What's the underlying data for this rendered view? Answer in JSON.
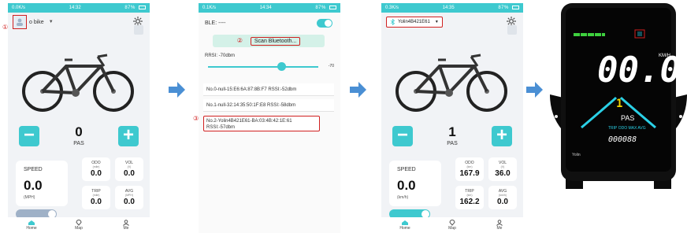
{
  "phone1": {
    "status_left": "0.0K/s",
    "status_time": "14:32",
    "status_right": "87% ",
    "annotation": "①",
    "device_name": "o bike",
    "pas_value": "0",
    "pas_label": "PAS",
    "speed": {
      "label": "SPEED",
      "value": "0.0",
      "unit": "(MPH)"
    },
    "odo": {
      "label": "ODO",
      "unit": "(mile)",
      "value": "0.0"
    },
    "vol": {
      "label": "VOL",
      "unit": "(V)",
      "value": "0.0"
    },
    "trip": {
      "label": "TRIP",
      "unit": "(mile)",
      "value": "0.0"
    },
    "avg": {
      "label": "AVG",
      "unit": "(MPH)",
      "value": "0.0"
    },
    "toggle_on": false
  },
  "phone2": {
    "status_left": "0.1K/s",
    "status_time": "14:34",
    "status_right": "87% ",
    "ble_label": "BLE: ----",
    "annotation_scan": "②",
    "scan_label": "Scan Bluetooth...",
    "rrsi_label": "RRSI: -70dbm",
    "slider_value": "-70",
    "devices": [
      "No.0-null-15:E6:6A:87:8B:F7 RSSI:-52dbm",
      "No.1-null-32:14:35:50:1F:E8 RSSI:-58dbm"
    ],
    "annotation_selected": "③",
    "selected_device_line1": "No.2-Yolin4B421E61-BA:03:4B:42:1E:61",
    "selected_device_line2": "RSSI:-57dbm"
  },
  "phone3": {
    "status_left": "0.3K/s",
    "status_time": "14:35",
    "status_right": "87% ",
    "device_name": "Yolin4B421E61",
    "pas_value": "1",
    "pas_label": "PAS",
    "speed": {
      "label": "SPEED",
      "value": "0.0",
      "unit": "(km/h)"
    },
    "odo": {
      "label": "ODO",
      "unit": "(km)",
      "value": "167.9"
    },
    "vol": {
      "label": "VOL",
      "unit": "(V)",
      "value": "36.0"
    },
    "trip": {
      "label": "TRIP",
      "unit": "(km)",
      "value": "162.2"
    },
    "avg": {
      "label": "AVG",
      "unit": "(km/h)",
      "value": "0.0"
    },
    "toggle_on": true
  },
  "tabs": [
    {
      "label": "Home"
    },
    {
      "label": "Map"
    },
    {
      "label": "Me"
    }
  ],
  "display": {
    "speed": "00.0",
    "speed_unit": "KM/H",
    "assist_level": "1",
    "pas_label": "PAS",
    "indicators": "TRIP ODO MAX AVG",
    "odometer": "000088",
    "brand": "Yolin",
    "accent_color": "#2ad0e6",
    "battery_color": "#3ed13e"
  },
  "colors": {
    "teal": "#3ec9cf",
    "arrow": "#4a8fd4",
    "annotation": "#d02020"
  }
}
